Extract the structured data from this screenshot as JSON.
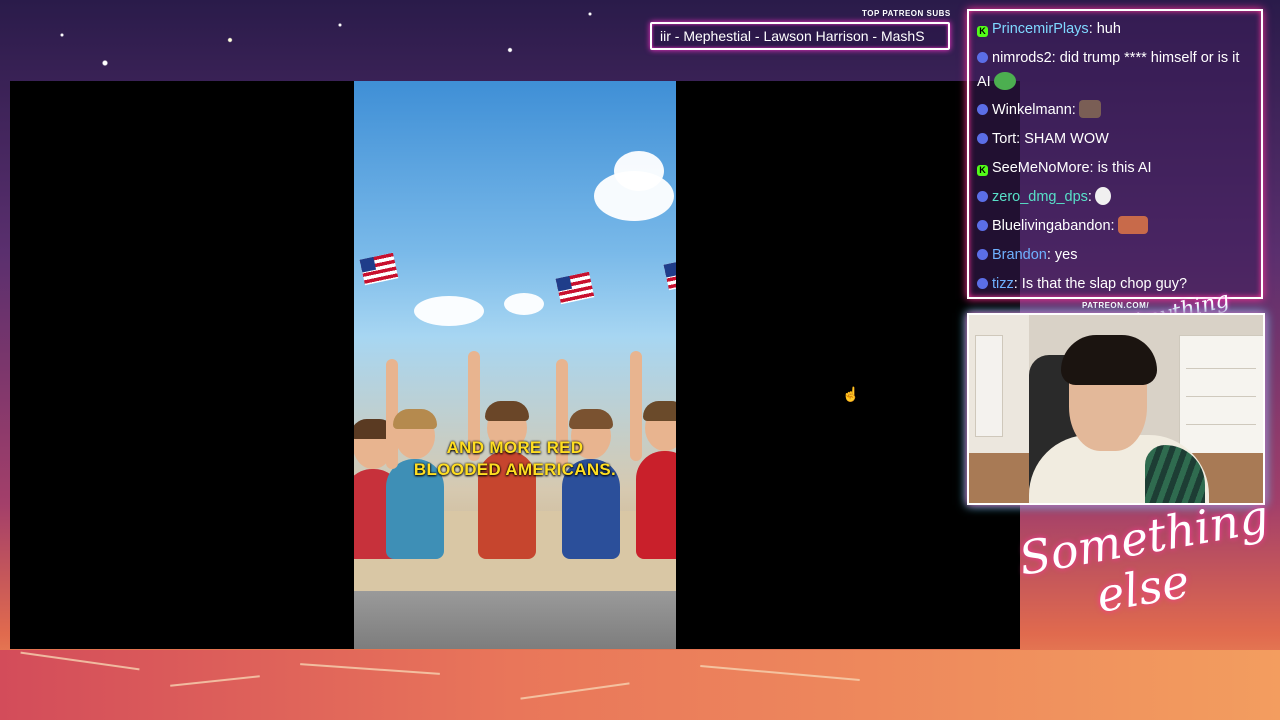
{
  "overlay": {
    "top_patreon_label": "TOP PATREON SUBS",
    "patreon_names_ticker": "iir - Mephestial - Lawson Harrison - MashS",
    "patreon_url": "PATREON.COM/",
    "logo_small": "Anything else",
    "brand_line1": "Something",
    "brand_line2": "else"
  },
  "video": {
    "caption_line1": "AND MORE RED",
    "caption_line2": "BLOODED AMERICANS."
  },
  "chat": {
    "messages": [
      {
        "user": "PrincemirPlays",
        "text": ": huh",
        "badge": "k",
        "user_color": "#7fd8ff"
      },
      {
        "user": "nimrods2",
        "text": ": did trump **** himself or is it AI",
        "badge": "t",
        "user_color": "#ffffff",
        "emote": "pepe"
      },
      {
        "user": "Winkelmann",
        "text": ":",
        "badge": "t",
        "user_color": "#ffffff",
        "emote": "face"
      },
      {
        "user": "Tort",
        "text": ": SHAM WOW",
        "badge": "t",
        "user_color": "#ffffff"
      },
      {
        "user": "SeeMeNoMore",
        "text": ": is this AI",
        "badge": "k",
        "user_color": "#ffffff"
      },
      {
        "user": "zero_dmg_dps",
        "text": ":",
        "badge": "t",
        "user_color": "#58e0c8",
        "emote": "skull"
      },
      {
        "user": "Bluelivingabandon",
        "text": ":",
        "badge": "t",
        "user_color": "#ffffff",
        "emote": "face2"
      },
      {
        "user": "Brandon",
        "text": ": yes",
        "badge": "t",
        "user_color": "#6fb1ff"
      },
      {
        "user": "tizz",
        "text": ": Is that the slap chop guy?",
        "badge": "t",
        "user_color": "#6fb1ff"
      }
    ]
  },
  "colors": {
    "neon_pink": "#ff33cc",
    "caption_yellow": "#ffde21"
  }
}
